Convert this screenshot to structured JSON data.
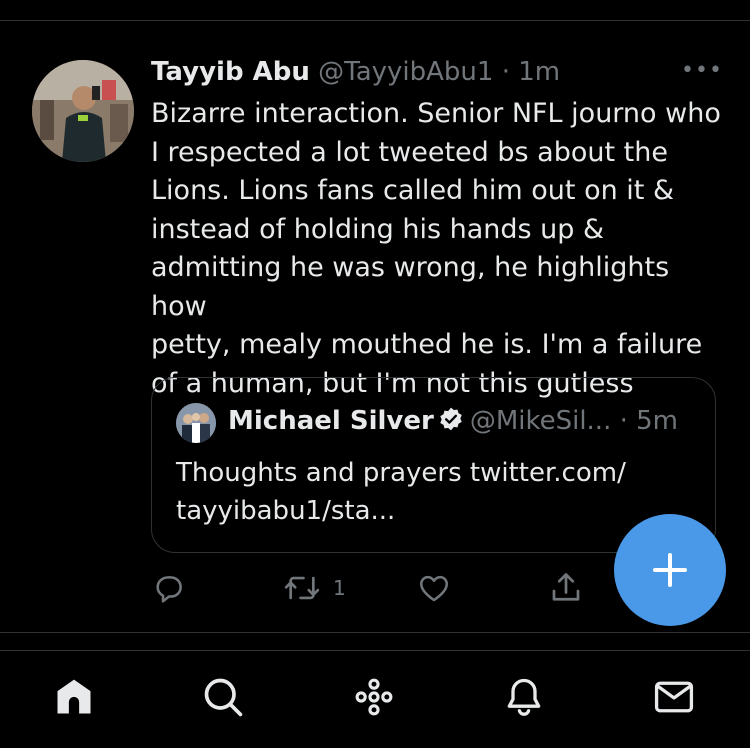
{
  "tweet": {
    "author_name": "Tayyib Abu",
    "author_handle": "@TayyibAbu1",
    "separator": "·",
    "time": "1m",
    "more_label": "•••",
    "text_lines": [
      "Bizarre interaction. Senior NFL journo who",
      "I respected a lot tweeted bs about the",
      "Lions. Lions fans called him out on it &",
      "instead of holding his hands up &",
      "admitting he was wrong, he highlights how",
      "petty, mealy mouthed he is. I'm a failure",
      "of a human, but I'm not this gutless"
    ]
  },
  "quote": {
    "author_name": "Michael Silver",
    "author_handle": "@MikeSil...",
    "separator": "·",
    "time": "5m",
    "text_lines": [
      "Thoughts and prayers twitter.com/",
      "tayyibabu1/sta..."
    ]
  },
  "actions": {
    "reply_icon": "reply-icon",
    "retweet_icon": "retweet-icon",
    "retweet_count": "1",
    "like_icon": "heart-icon",
    "share_icon": "share-icon"
  },
  "fab": {
    "icon": "plus-icon",
    "color": "#4a99e9"
  },
  "bottom_nav": {
    "items": [
      "home-icon",
      "search-icon",
      "spaces-icon",
      "notifications-icon",
      "messages-icon"
    ]
  },
  "colors": {
    "background": "#000000",
    "text": "#e7e9ea",
    "muted": "#71767b",
    "divider": "#2f3336",
    "accent": "#4a99e9"
  }
}
